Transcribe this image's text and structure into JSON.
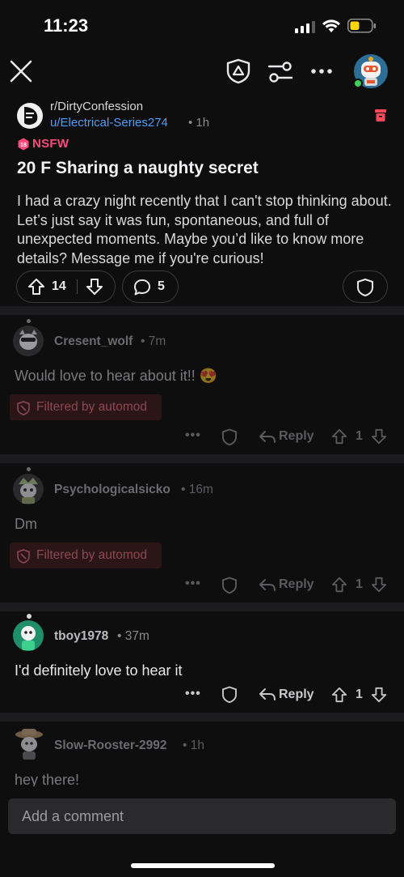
{
  "status_bar": {
    "time": "11:23"
  },
  "post": {
    "subreddit": "r/DirtyConfession",
    "author": "u/Electrical-Series274",
    "age": "• 1h",
    "nsfw_label": "NSFW",
    "title": "20 F Sharing a naughty secret",
    "body": "I had a crazy night recently that I can't stop thinking about. Let’s just say it was fun, spontaneous, and full of unexpected moments. Maybe you’d like to know more details? Message me if you're curious!",
    "upvotes": "14",
    "comments": "5"
  },
  "comments": [
    {
      "user": "Cresent_wolf",
      "age": "• 7m",
      "text": "Would love to hear about it!!",
      "emoji": "😍",
      "filtered_label": "Filtered by automod",
      "reply_label": "Reply",
      "votes": "1"
    },
    {
      "user": "Psychologicalsicko",
      "age": "• 16m",
      "text": "Dm",
      "filtered_label": "Filtered by automod",
      "reply_label": "Reply",
      "votes": "1"
    },
    {
      "user": "tboy1978",
      "age": "• 37m",
      "text": "I'd definitely love to hear it",
      "reply_label": "Reply",
      "votes": "1"
    },
    {
      "user": "Slow-Rooster-2992",
      "age": "• 1h",
      "text": "hey there!"
    }
  ],
  "composer": {
    "placeholder": "Add a comment"
  },
  "colors": {
    "background": "#0e0e0f",
    "link": "#4f9cf2",
    "nsfw": "#ff4a7d",
    "online": "#3ecf5a",
    "battery": "#ffd60a"
  },
  "icons": [
    "close-icon",
    "mod-shield-icon",
    "filter-icon",
    "more-icon",
    "avatar",
    "trash-icon",
    "upvote-icon",
    "downvote-icon",
    "comment-icon",
    "shield-icon",
    "reply-icon",
    "ban-icon"
  ]
}
